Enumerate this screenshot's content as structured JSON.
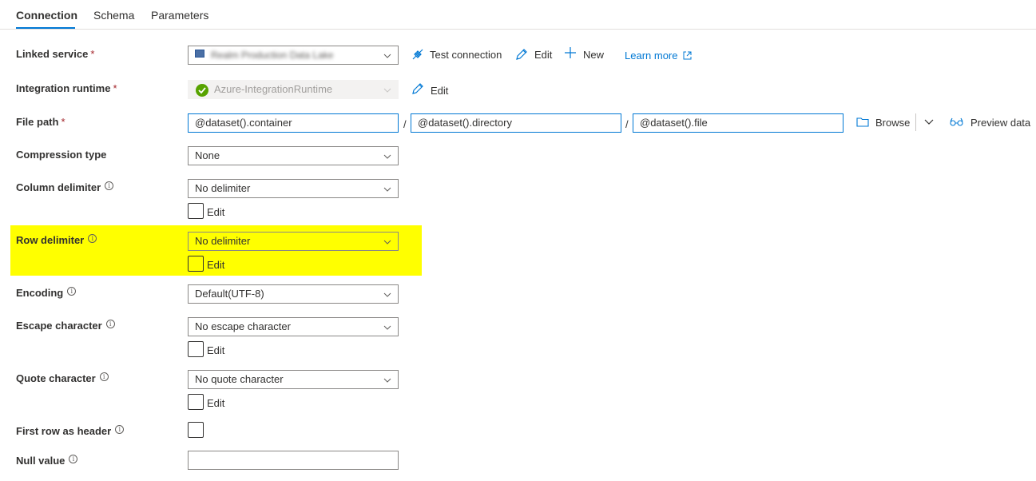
{
  "tabs": [
    {
      "label": "Connection",
      "active": true
    },
    {
      "label": "Schema",
      "active": false
    },
    {
      "label": "Parameters",
      "active": false
    }
  ],
  "fields": {
    "linked_service": {
      "label": "Linked service",
      "required": "*",
      "value": "Realm Production Data Lake"
    },
    "integration_runtime": {
      "label": "Integration runtime",
      "required": "*",
      "value": "Azure-IntegrationRuntime"
    },
    "file_path": {
      "label": "File path",
      "required": "*",
      "container": "@dataset().container",
      "directory": "@dataset().directory",
      "file": "@dataset().file",
      "separator": "/"
    },
    "compression_type": {
      "label": "Compression type",
      "value": "None"
    },
    "column_delimiter": {
      "label": "Column delimiter",
      "value": "No delimiter",
      "edit_label": "Edit"
    },
    "row_delimiter": {
      "label": "Row delimiter",
      "value": "No delimiter",
      "edit_label": "Edit"
    },
    "encoding": {
      "label": "Encoding",
      "value": "Default(UTF-8)"
    },
    "escape_character": {
      "label": "Escape character",
      "value": "No escape character",
      "edit_label": "Edit"
    },
    "quote_character": {
      "label": "Quote character",
      "value": "No quote character",
      "edit_label": "Edit"
    },
    "first_row_header": {
      "label": "First row as header",
      "checked": false
    },
    "null_value": {
      "label": "Null value",
      "value": ""
    }
  },
  "actions": {
    "test_connection": "Test connection",
    "edit": "Edit",
    "new": "New",
    "learn_more": "Learn more",
    "runtime_edit": "Edit",
    "browse": "Browse",
    "preview_data": "Preview data"
  },
  "info_glyph": "i",
  "colors": {
    "accent": "#0078d4",
    "highlight": "#ffff00",
    "required": "#a4262c",
    "success": "#57a300"
  }
}
